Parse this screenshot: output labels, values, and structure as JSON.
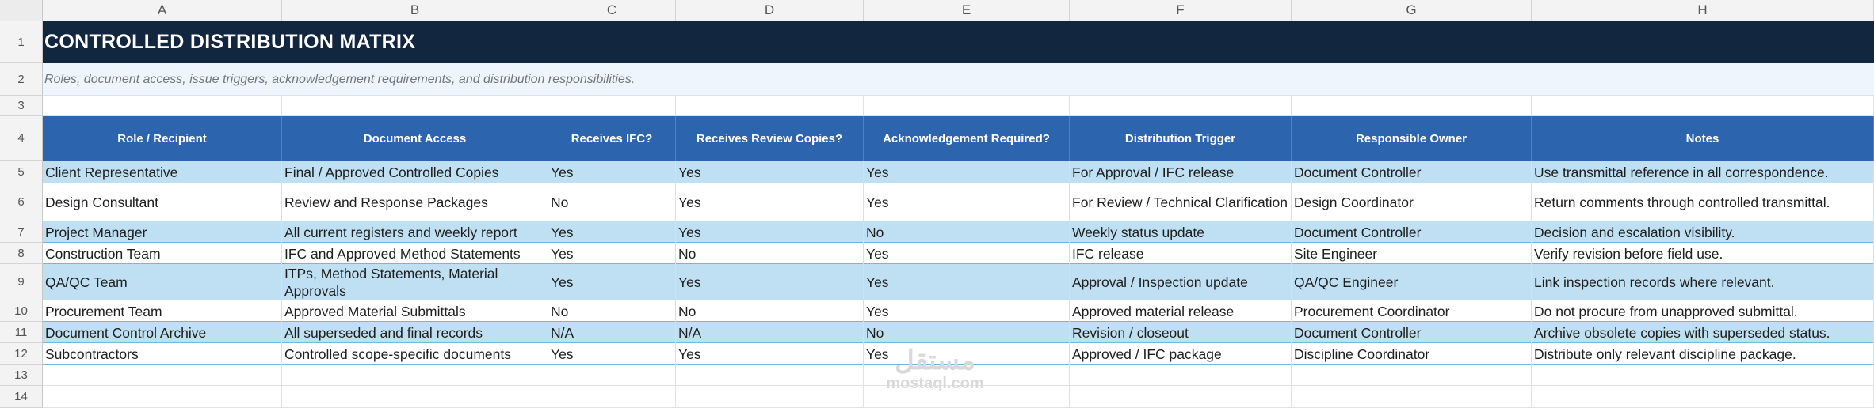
{
  "sheet": {
    "column_letters": [
      "A",
      "B",
      "C",
      "D",
      "E",
      "F",
      "G",
      "H"
    ],
    "row_numbers": [
      "1",
      "2",
      "3",
      "4",
      "5",
      "6",
      "7",
      "8",
      "9",
      "10",
      "11",
      "12",
      "13",
      "14"
    ],
    "title": "CONTROLLED DISTRIBUTION MATRIX",
    "subtitle": "Roles, document access, issue triggers, acknowledgement requirements, and distribution responsibilities.",
    "headers": [
      "Role / Recipient",
      "Document Access",
      "Receives IFC?",
      "Receives Review Copies?",
      "Acknowledgement Required?",
      "Distribution Trigger",
      "Responsible Owner",
      "Notes"
    ],
    "rows": [
      [
        "Client Representative",
        "Final / Approved Controlled Copies",
        "Yes",
        "Yes",
        "Yes",
        "For Approval / IFC release",
        "Document Controller",
        "Use transmittal reference in all correspondence."
      ],
      [
        "Design Consultant",
        "Review and Response Packages",
        "No",
        "Yes",
        "Yes",
        "For Review / Technical Clarification",
        "Design Coordinator",
        "Return comments through controlled transmittal."
      ],
      [
        "Project Manager",
        "All current registers and weekly report",
        "Yes",
        "Yes",
        "No",
        "Weekly status update",
        "Document Controller",
        "Decision and escalation visibility."
      ],
      [
        "Construction Team",
        "IFC and Approved Method Statements",
        "Yes",
        "No",
        "Yes",
        "IFC release",
        "Site Engineer",
        "Verify revision before field use."
      ],
      [
        "QA/QC Team",
        "ITPs, Method Statements, Material Approvals",
        "Yes",
        "Yes",
        "Yes",
        "Approval / Inspection update",
        "QA/QC Engineer",
        "Link inspection records where relevant."
      ],
      [
        "Procurement Team",
        "Approved Material Submittals",
        "No",
        "No",
        "Yes",
        "Approved material release",
        "Procurement Coordinator",
        "Do not procure from unapproved submittal."
      ],
      [
        "Document Control Archive",
        "All superseded and final records",
        "N/A",
        "N/A",
        "No",
        "Revision / closeout",
        "Document Controller",
        "Archive obsolete copies with superseded status."
      ],
      [
        "Subcontractors",
        "Controlled scope-specific documents",
        "Yes",
        "Yes",
        "Yes",
        "Approved / IFC package",
        "Discipline Coordinator",
        "Distribute only relevant discipline package."
      ]
    ]
  },
  "watermark": {
    "arabic": "مستقل",
    "latin": "mostaql.com"
  },
  "colors": {
    "title_band": "#12263f",
    "header_band": "#2d64ae",
    "striped_row": "#bfe0f3",
    "subtitle_band": "#eef5fc"
  }
}
